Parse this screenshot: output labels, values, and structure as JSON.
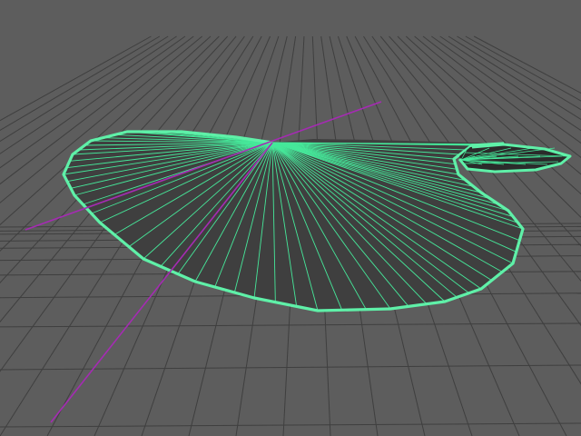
{
  "viewport": {
    "background": "#5d5d5d",
    "grid_color": "#3f3f3f",
    "grid_visible": true
  },
  "scene": {
    "object_outline_color": "#5ff0a8",
    "object_face_color": "#3f3f3f",
    "object_wire_color": "#46e89a",
    "pivot_axis_color": "#a52bb3",
    "object_selected": true
  }
}
